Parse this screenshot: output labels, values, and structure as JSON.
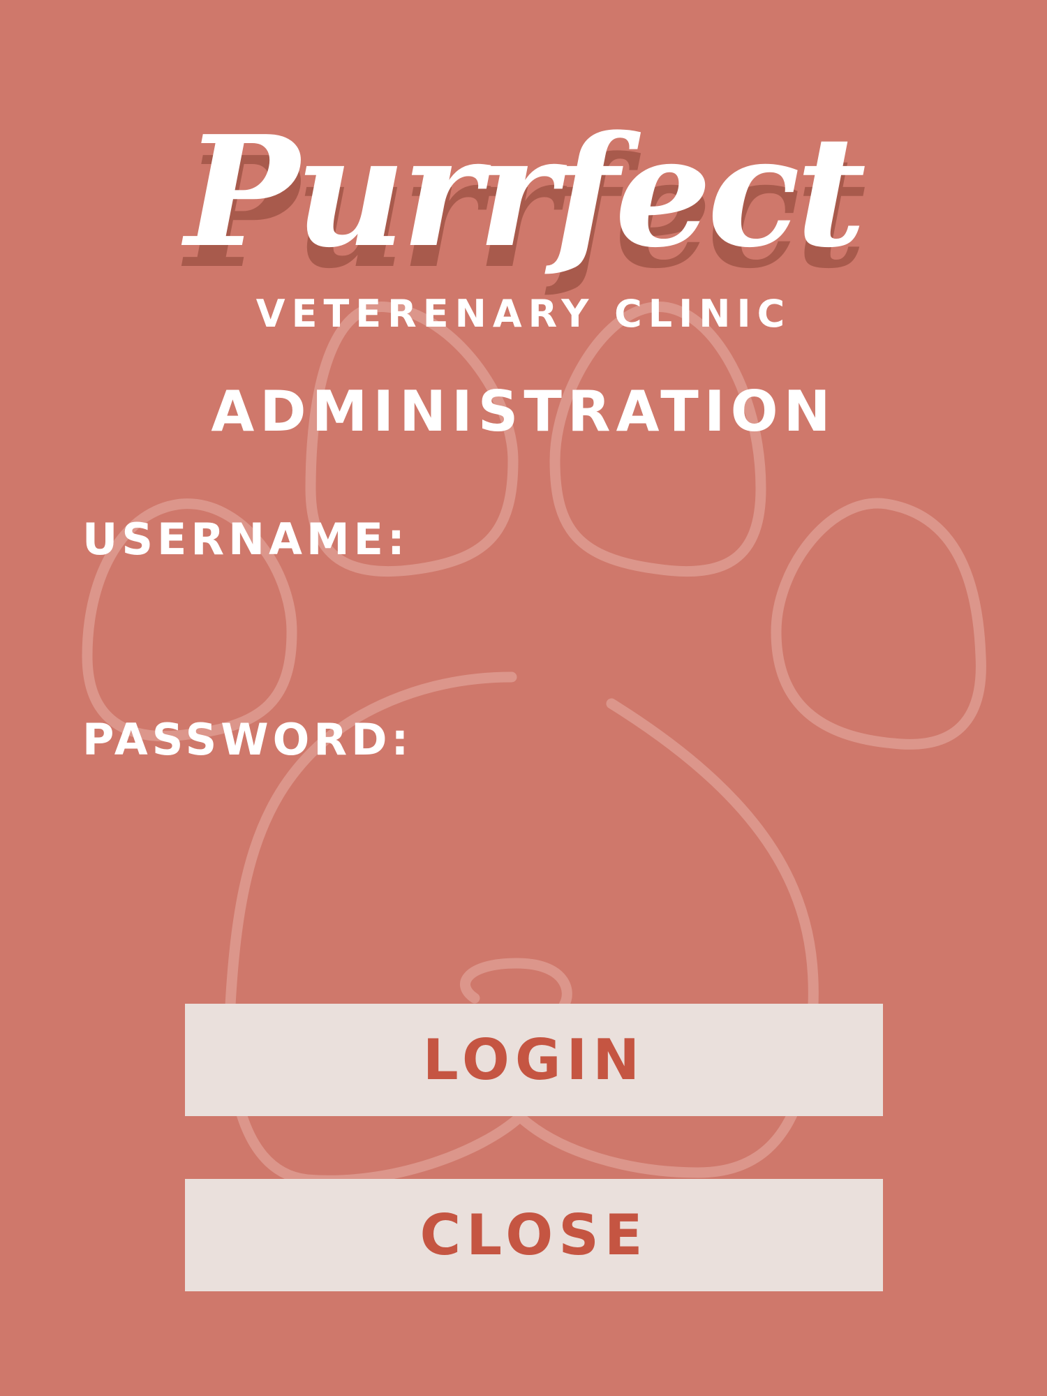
{
  "brand": {
    "logo_text": "Purrfect",
    "subtitle": "VETERENARY CLINIC"
  },
  "page": {
    "title": "ADMINISTRATION"
  },
  "form": {
    "username_label": "USERNAME:",
    "username_value": "",
    "password_label": "PASSWORD:",
    "password_value": ""
  },
  "buttons": {
    "login_label": "LOGIN",
    "close_label": "CLOSE"
  },
  "colors": {
    "background": "#cf786b",
    "logo_shadow": "#a85a4c",
    "button_bg": "#eae0dc",
    "button_text": "#c55542",
    "paw_outline": "#e0a095"
  },
  "icons": {
    "background_graphic": "paw-print-icon"
  }
}
